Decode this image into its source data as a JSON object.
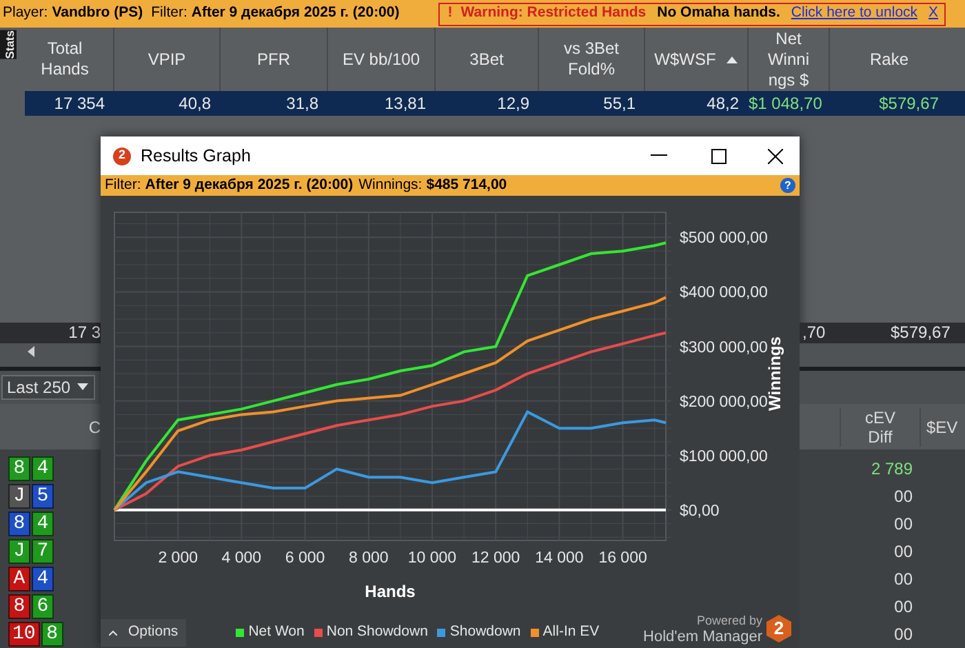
{
  "top_bar": {
    "player_label": "Player:",
    "player": "Vandbro (PS)",
    "filter_label": "Filter:",
    "filter": "After 9 декабря 2025 г. (20:00)",
    "warning_icon": "!",
    "warning": "Warning: Restricted Hands",
    "notice": "No Omaha hands.",
    "unlock_link": "Click here to unlock",
    "close": "X"
  },
  "stats_tab": "Stats",
  "stats_table": {
    "columns": [
      {
        "label": "Total Hands",
        "sorted": false
      },
      {
        "label": "VPIP",
        "sorted": false
      },
      {
        "label": "PFR",
        "sorted": false
      },
      {
        "label": "EV bb/100",
        "sorted": false
      },
      {
        "label": "3Bet",
        "sorted": false
      },
      {
        "label": "vs 3Bet Fold%",
        "sorted": false
      },
      {
        "label": "W$WSF",
        "sorted": true
      },
      {
        "label": "Net Winnings $",
        "sorted": false
      },
      {
        "label": "Rake",
        "sorted": false
      }
    ],
    "row": {
      "selected": true,
      "cells": [
        "17 354",
        "40,8",
        "31,8",
        "13,81",
        "12,9",
        "55,1",
        "48,2",
        "$1 048,70",
        "$579,67"
      ]
    },
    "summary_left": "17 3",
    "summary_right": [
      ",70",
      "$579,67"
    ]
  },
  "hands_panel": {
    "range": "Last 250",
    "column_left": "C",
    "columns_right": [
      "cEV Diff",
      "$EV"
    ],
    "rows": [
      {
        "cards": [
          {
            "rank": "8",
            "color": "#1f9a1f"
          },
          {
            "rank": "4",
            "color": "#1f9a1f"
          }
        ],
        "cev": "2 789",
        "positive": true
      },
      {
        "cards": [
          {
            "rank": "J",
            "color": "#555555"
          },
          {
            "rank": "5",
            "color": "#1f4fc4"
          }
        ],
        "cev": "00",
        "positive": false
      },
      {
        "cards": [
          {
            "rank": "8",
            "color": "#1f4fc4"
          },
          {
            "rank": "4",
            "color": "#1f9a1f"
          }
        ],
        "cev": "00",
        "positive": false
      },
      {
        "cards": [
          {
            "rank": "J",
            "color": "#1f9a1f"
          },
          {
            "rank": "7",
            "color": "#1f9a1f"
          }
        ],
        "cev": "00",
        "positive": false
      },
      {
        "cards": [
          {
            "rank": "A",
            "color": "#c41414"
          },
          {
            "rank": "4",
            "color": "#1f4fc4"
          }
        ],
        "cev": "00",
        "positive": false
      },
      {
        "cards": [
          {
            "rank": "8",
            "color": "#c41414"
          },
          {
            "rank": "6",
            "color": "#1f9a1f"
          }
        ],
        "cev": "00",
        "positive": false
      },
      {
        "cards": [
          {
            "rank": "10",
            "color": "#c41414"
          },
          {
            "rank": "8",
            "color": "#1f9a1f"
          }
        ],
        "cev": "00",
        "positive": false
      }
    ]
  },
  "dialog": {
    "title": "Results Graph",
    "logo": "2",
    "filter_label": "Filter:",
    "filter": "After 9 декабря 2025 г. (20:00)",
    "winnings_label": "Winnings:",
    "winnings": "$485 714,00",
    "help": "?",
    "chart_data": {
      "type": "line",
      "grid": true,
      "xlabel": "Hands",
      "ylabel": "Winnings",
      "x": [
        0,
        1000,
        2000,
        3000,
        4000,
        5000,
        6000,
        7000,
        8000,
        9000,
        10000,
        11000,
        12000,
        13000,
        14000,
        15000,
        16000,
        17000,
        17354
      ],
      "series": [
        {
          "name": "Net Won",
          "color": "#33e633",
          "values": [
            0,
            90000,
            165000,
            175000,
            185000,
            200000,
            215000,
            230000,
            240000,
            255000,
            265000,
            290000,
            300000,
            430000,
            450000,
            470000,
            475000,
            485000,
            490000
          ]
        },
        {
          "name": "Non Showdown",
          "color": "#e84c4c",
          "values": [
            0,
            30000,
            80000,
            100000,
            110000,
            125000,
            140000,
            155000,
            165000,
            175000,
            190000,
            200000,
            220000,
            250000,
            270000,
            290000,
            305000,
            320000,
            325000
          ]
        },
        {
          "name": "Showdown",
          "color": "#3a9ae0",
          "values": [
            0,
            50000,
            70000,
            60000,
            50000,
            40000,
            40000,
            75000,
            60000,
            60000,
            50000,
            60000,
            70000,
            180000,
            150000,
            150000,
            160000,
            165000,
            160000
          ]
        },
        {
          "name": "All-In EV",
          "color": "#f0902a",
          "values": [
            0,
            70000,
            145000,
            165000,
            175000,
            180000,
            190000,
            200000,
            205000,
            210000,
            230000,
            250000,
            270000,
            310000,
            330000,
            350000,
            365000,
            380000,
            390000
          ]
        }
      ],
      "xlim": [
        0,
        17354
      ],
      "ylim": [
        -56000,
        546000
      ],
      "xticks": [
        {
          "value": 2000,
          "label": "2 000"
        },
        {
          "value": 4000,
          "label": "4 000"
        },
        {
          "value": 6000,
          "label": "6 000"
        },
        {
          "value": 8000,
          "label": "8 000"
        },
        {
          "value": 10000,
          "label": "10 000"
        },
        {
          "value": 12000,
          "label": "12 000"
        },
        {
          "value": 14000,
          "label": "14 000"
        },
        {
          "value": 16000,
          "label": "16 000"
        }
      ],
      "yticks": [
        {
          "value": 0,
          "label": "$0,00"
        },
        {
          "value": 100000,
          "label": "$100 000,00"
        },
        {
          "value": 200000,
          "label": "$200 000,00"
        },
        {
          "value": 300000,
          "label": "$300 000,00"
        },
        {
          "value": 400000,
          "label": "$400 000,00"
        },
        {
          "value": 500000,
          "label": "$500 000,00"
        }
      ]
    },
    "options_button": "Options",
    "powered_by": "Powered by",
    "brand": "Hold'em Manager",
    "brand_logo": "2"
  }
}
